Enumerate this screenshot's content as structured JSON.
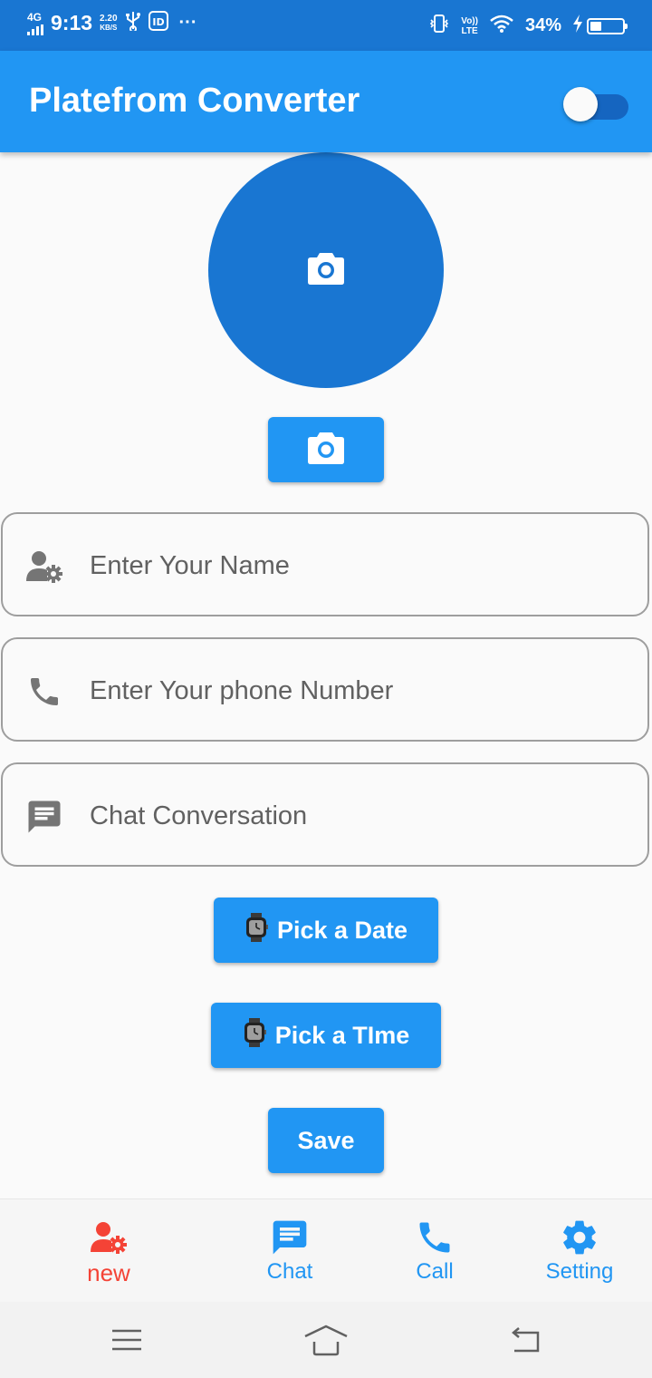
{
  "status_bar": {
    "network": "4G",
    "time": "9:13",
    "speed_value": "2.20",
    "speed_unit": "KB/S",
    "more": "···",
    "volte_top": "Vo))",
    "volte_bottom": "LTE",
    "battery_percent": "34%",
    "battery_level": 0.34
  },
  "app_bar": {
    "title": "Platefrom Converter",
    "toggle_on": false
  },
  "form": {
    "name_placeholder": "Enter Your Name",
    "phone_placeholder": "Enter Your phone Number",
    "chat_placeholder": "Chat Conversation",
    "pick_date_label": "Pick a Date",
    "pick_time_label": "Pick a TIme",
    "save_label": "Save"
  },
  "bottom_nav": {
    "items": [
      {
        "label": "new",
        "icon": "person-gear-icon",
        "color": "#f44336"
      },
      {
        "label": "Chat",
        "icon": "chat-icon",
        "color": "#2196f3"
      },
      {
        "label": "Call",
        "icon": "phone-icon",
        "color": "#2196f3"
      },
      {
        "label": "Setting",
        "icon": "gear-icon",
        "color": "#2196f3"
      }
    ]
  },
  "colors": {
    "primary": "#2196f3",
    "primary_dark": "#1976d2",
    "selected_nav": "#f44336"
  }
}
